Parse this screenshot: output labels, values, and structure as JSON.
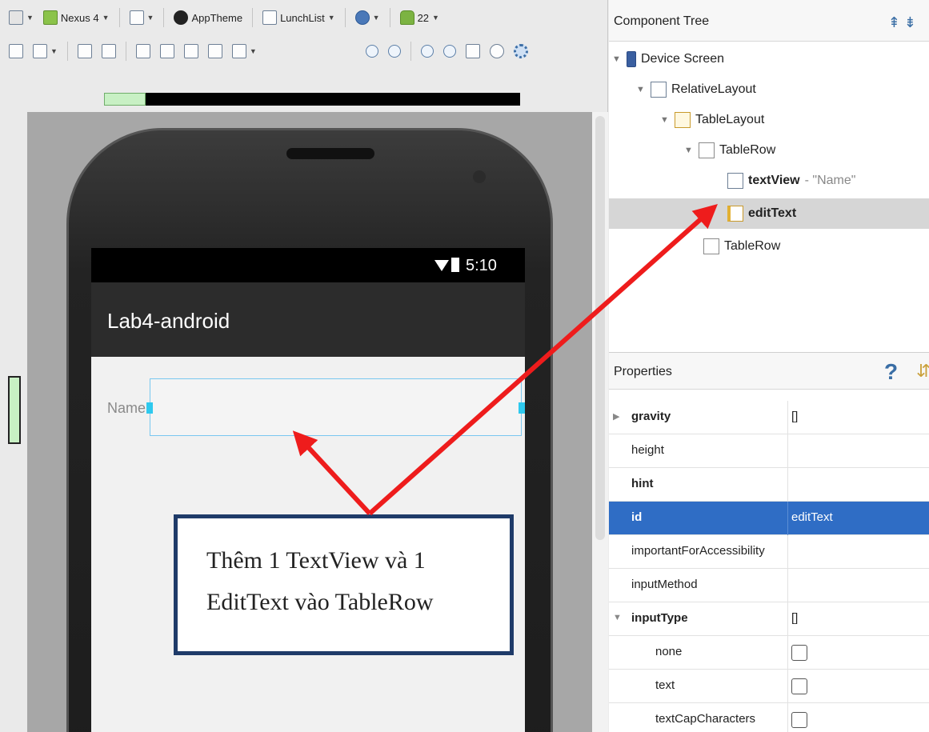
{
  "toolbar": {
    "device": "Nexus 4",
    "theme": "AppTheme",
    "activity": "LunchList",
    "api": "22"
  },
  "device_screen": {
    "status_time": "5:10",
    "app_title": "Lab4-android",
    "name_label": "Name"
  },
  "annotation": {
    "line1": "Thêm 1 TextView và 1",
    "line2": "EditText vào TableRow"
  },
  "component_tree": {
    "title": "Component Tree",
    "nodes": [
      {
        "label": "Device Screen",
        "icon": "device-icon"
      },
      {
        "label": "RelativeLayout",
        "icon": "relative-layout-icon"
      },
      {
        "label": "TableLayout",
        "icon": "table-layout-icon"
      },
      {
        "label": "TableRow",
        "icon": "table-row-icon"
      },
      {
        "label": "textView",
        "suffix": " - \"Name\"",
        "icon": "text-view-icon"
      },
      {
        "label": "editText",
        "icon": "edit-text-icon",
        "selected": true
      },
      {
        "label": "TableRow",
        "icon": "table-row-icon"
      }
    ]
  },
  "properties": {
    "title": "Properties",
    "help": "?",
    "rows": [
      {
        "name": "gravity",
        "value": "[]",
        "bold": true,
        "expander": true
      },
      {
        "name": "height",
        "value": ""
      },
      {
        "name": "hint",
        "value": "",
        "bold": true
      },
      {
        "name": "id",
        "value": "editText",
        "bold": true,
        "selected": true
      },
      {
        "name": "importantForAccessibility",
        "value": ""
      },
      {
        "name": "inputMethod",
        "value": ""
      },
      {
        "name": "inputType",
        "value": "[]",
        "bold": true,
        "expander": true
      },
      {
        "name": "none",
        "value": "checkbox",
        "indent": true
      },
      {
        "name": "text",
        "value": "checkbox",
        "indent": true
      },
      {
        "name": "textCapCharacters",
        "value": "checkbox",
        "indent": true
      }
    ]
  },
  "colors": {
    "selection": "#2f6dc5",
    "arrow": "#ee1c1c",
    "note_border": "#1f3b69",
    "appbar": "#2c2c2c"
  }
}
